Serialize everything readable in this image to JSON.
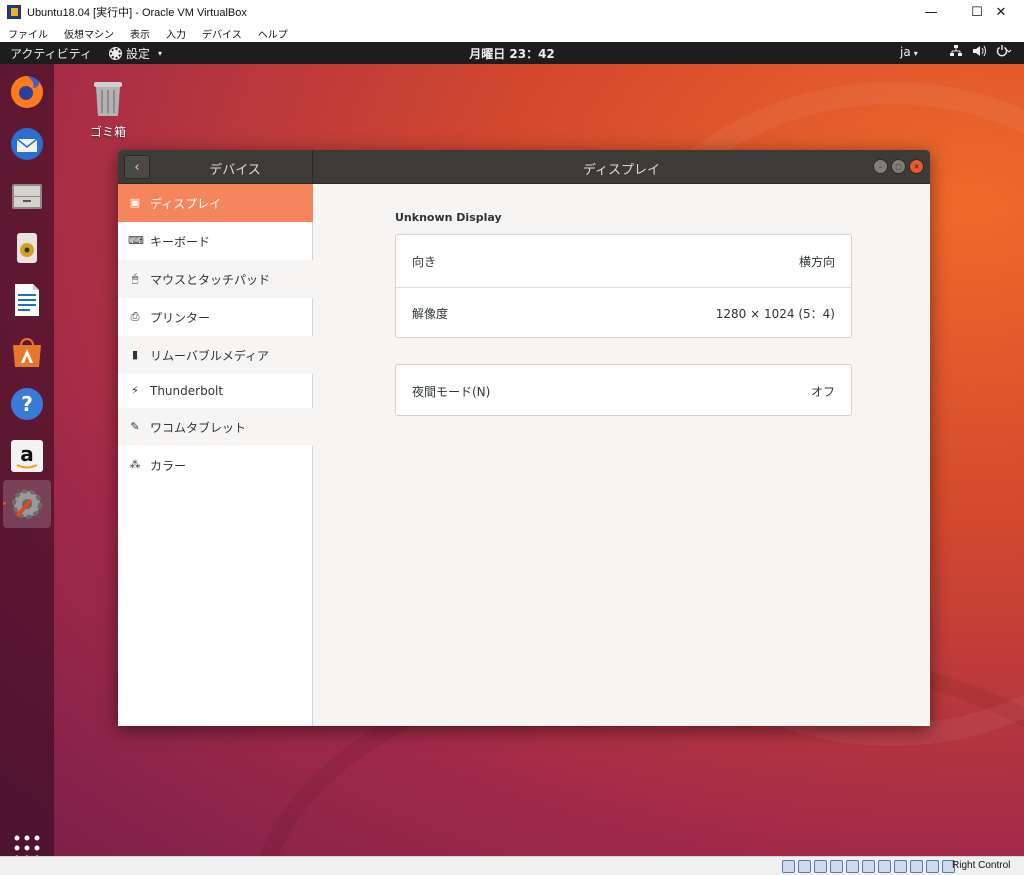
{
  "host": {
    "title": "Ubuntu18.04 [実行中] - Oracle VM VirtualBox",
    "controls": {
      "minimize": "—",
      "maximize": "☐",
      "close": "✕"
    },
    "menu": [
      "ファイル",
      "仮想マシン",
      "表示",
      "入力",
      "デバイス",
      "ヘルプ"
    ],
    "status": {
      "host_key": "Right Control"
    }
  },
  "topbar": {
    "activities": "アクティビティ",
    "app_menu": "設定",
    "caret": "▾",
    "clock": "月曜日 23：42",
    "language": "ja"
  },
  "dock": {
    "items": [
      "firefox-icon",
      "thunderbird-icon",
      "files-icon",
      "rhythmbox-icon",
      "libreoffice-writer-icon",
      "ubuntu-software-icon",
      "help-icon",
      "amazon-icon",
      "settings-icon",
      "show-applications-icon"
    ]
  },
  "desktop": {
    "trash_label": "ゴミ箱"
  },
  "window": {
    "back": "‹",
    "section_title": "デバイス",
    "page_title": "ディスプレイ",
    "sidebar": [
      {
        "label": "ディスプレイ",
        "icon": "display-icon",
        "selected": true
      },
      {
        "label": "キーボード",
        "icon": "keyboard-icon"
      },
      {
        "label": "マウスとタッチパッド",
        "icon": "mouse-icon"
      },
      {
        "label": "プリンター",
        "icon": "printer-icon"
      },
      {
        "label": "リムーバブルメディア",
        "icon": "usb-icon"
      },
      {
        "label": "Thunderbolt",
        "icon": "thunderbolt-icon"
      },
      {
        "label": "ワコムタブレット",
        "icon": "tablet-icon"
      },
      {
        "label": "カラー",
        "icon": "color-icon"
      }
    ],
    "content": {
      "display_name": "Unknown Display",
      "orientation": {
        "label": "向き",
        "value": "横方向"
      },
      "resolution": {
        "label": "解像度",
        "value": "1280 × 1024 (5：4)"
      },
      "night_mode": {
        "label": "夜間モード(N)",
        "value": "オフ"
      }
    }
  },
  "colors": {
    "accent": "#e95420",
    "selected_row": "#f4855c",
    "header": "#3c3b37",
    "topbar": "#1d1d1d"
  }
}
